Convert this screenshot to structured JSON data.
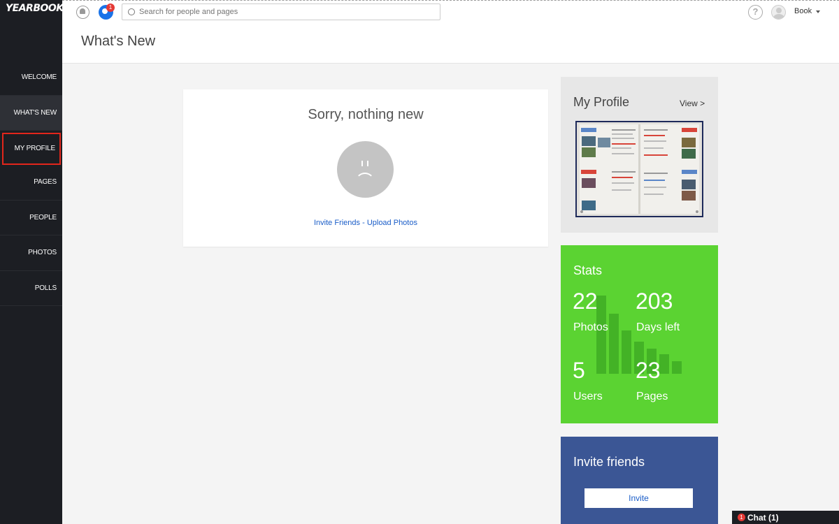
{
  "app": {
    "logo": "YEARBOOK"
  },
  "sidebar": {
    "items": [
      {
        "label": "WELCOME"
      },
      {
        "label": "WHAT'S NEW"
      },
      {
        "label": "MY PROFILE"
      },
      {
        "label": "PAGES"
      },
      {
        "label": "PEOPLE"
      },
      {
        "label": "PHOTOS"
      },
      {
        "label": "POLLS"
      }
    ]
  },
  "topbar": {
    "notification_count": "1",
    "search_placeholder": "Search for people and pages",
    "help_glyph": "?",
    "user_name": "Book"
  },
  "header": {
    "title": "What's New"
  },
  "feed": {
    "empty_title": "Sorry, nothing new",
    "invite_link": "Invite Friends",
    "separator": " - ",
    "upload_link": "Upload Photos"
  },
  "profile": {
    "title": "My Profile",
    "view_link": "View >"
  },
  "stats": {
    "title": "Stats",
    "photos_value": "22",
    "photos_label": "Photos",
    "days_value": "203",
    "days_label": "Days left",
    "users_value": "5",
    "users_label": "Users",
    "pages_value": "23",
    "pages_label": "Pages"
  },
  "invite": {
    "title": "Invite friends",
    "button": "Invite"
  },
  "chat": {
    "label": "Chat (1)",
    "badge": "1"
  },
  "colors": {
    "sidebar": "#1c1e23",
    "stats_green": "#5bd332",
    "invite_blue": "#3b5695",
    "highlight_red": "#e2261b",
    "link_blue": "#1a5dc8"
  }
}
